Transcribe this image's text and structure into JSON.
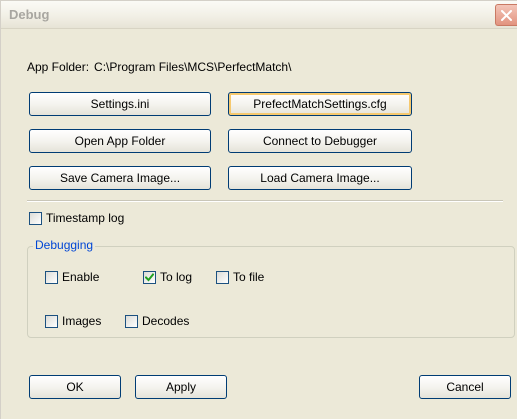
{
  "window": {
    "title": "Debug"
  },
  "app_folder": {
    "label": "App Folder:",
    "path": "C:\\Program Files\\MCS\\PerfectMatch\\"
  },
  "buttons": {
    "settings_ini": "Settings.ini",
    "prefect_cfg": "PrefectMatchSettings.cfg",
    "open_app_folder": "Open App Folder",
    "connect_debugger": "Connect to Debugger",
    "save_camera": "Save Camera Image...",
    "load_camera": "Load Camera Image...",
    "ok": "OK",
    "apply": "Apply",
    "cancel": "Cancel"
  },
  "timestamp_log": {
    "label": "Timestamp log",
    "checked": false
  },
  "debugging": {
    "legend": "Debugging",
    "enable": {
      "label": "Enable",
      "checked": false
    },
    "to_log": {
      "label": "To log",
      "checked": true
    },
    "to_file": {
      "label": "To file",
      "checked": false
    },
    "images": {
      "label": "Images",
      "checked": false
    },
    "decodes": {
      "label": "Decodes",
      "checked": false
    }
  },
  "colors": {
    "window_bg": "#ece9d8",
    "button_border": "#003c74",
    "group_legend": "#0046d5",
    "check_mark": "#21a121",
    "close_button": "#e2937f"
  },
  "icons": {
    "close": "close-icon",
    "check": "check-icon"
  }
}
